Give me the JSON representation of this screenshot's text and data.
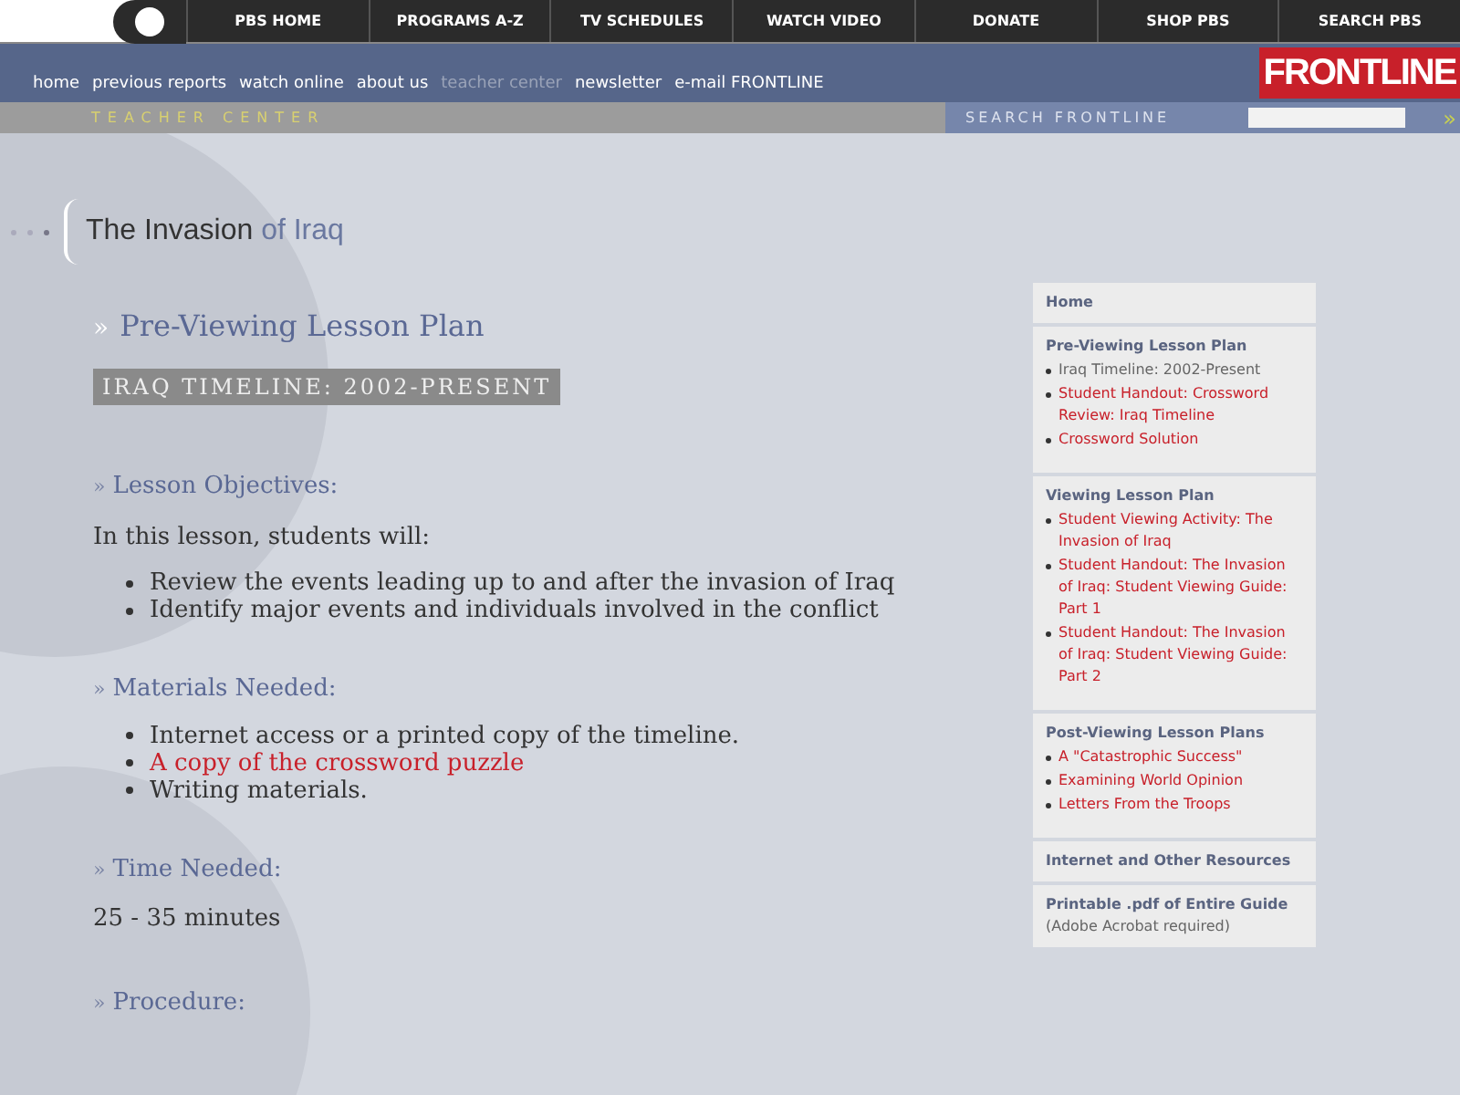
{
  "top_nav": [
    "PBS HOME",
    "PROGRAMS A-Z",
    "TV SCHEDULES",
    "WATCH VIDEO",
    "DONATE",
    "SHOP PBS",
    "SEARCH PBS"
  ],
  "site_nav": [
    {
      "label": "home",
      "current": false
    },
    {
      "label": "previous reports",
      "current": false
    },
    {
      "label": "watch online",
      "current": false
    },
    {
      "label": "about us",
      "current": false
    },
    {
      "label": "teacher center",
      "current": true
    },
    {
      "label": "newsletter",
      "current": false
    },
    {
      "label": "e-mail FRONTLINE",
      "current": false
    }
  ],
  "logo": "FRONTLINE",
  "section_bar": {
    "title": "TEACHER CENTER",
    "search_label": "SEARCH FRONTLINE",
    "search_go": "»"
  },
  "guide_title": {
    "main": "The Invasion",
    "rest": "of Iraq"
  },
  "page_heading": {
    "marker": "»",
    "text": "Pre-Viewing Lesson Plan"
  },
  "badge": "IRAQ TIMELINE: 2002-PRESENT",
  "sections": [
    {
      "marker": "»",
      "heading": "Lesson Objectives:",
      "intro": "In this lesson, students will:",
      "items": [
        {
          "text": "Review the events leading up to and after the invasion of Iraq",
          "link": false
        },
        {
          "text": "Identify major events and individuals involved in the conflict",
          "link": false
        }
      ]
    },
    {
      "marker": "»",
      "heading": "Materials Needed:",
      "items": [
        {
          "text": "Internet access or a printed copy of the timeline.",
          "link": false
        },
        {
          "text": "A copy of the crossword puzzle",
          "link": true
        },
        {
          "text": "Writing materials.",
          "link": false
        }
      ]
    },
    {
      "marker": "»",
      "heading": "Time Needed:",
      "intro": "25 - 35 minutes"
    },
    {
      "marker": "»",
      "heading": "Procedure:"
    }
  ],
  "sidebar": [
    {
      "title": "Home"
    },
    {
      "title": "Pre-Viewing Lesson Plan",
      "items": [
        {
          "text": "Iraq Timeline: 2002-Present",
          "current": true
        },
        {
          "text": "Student Handout: Crossword Review: Iraq Timeline",
          "current": false
        },
        {
          "text": "Crossword Solution",
          "current": false
        }
      ]
    },
    {
      "title": "Viewing Lesson Plan",
      "items": [
        {
          "text": "Student Viewing Activity: The Invasion of Iraq",
          "current": false
        },
        {
          "text": "Student Handout: The Invasion of Iraq: Student Viewing Guide: Part 1",
          "current": false
        },
        {
          "text": "Student Handout: The Invasion of Iraq: Student Viewing Guide: Part 2",
          "current": false
        }
      ]
    },
    {
      "title": "Post-Viewing Lesson Plans",
      "items": [
        {
          "text": "A \"Catastrophic Success\"",
          "current": false
        },
        {
          "text": "Examining World Opinion",
          "current": false
        },
        {
          "text": "Letters From the Troops",
          "current": false
        }
      ]
    },
    {
      "title": "Internet and Other Resources"
    },
    {
      "title": "Printable .pdf of Entire Guide",
      "note": "(Adobe Acrobat required)"
    }
  ]
}
